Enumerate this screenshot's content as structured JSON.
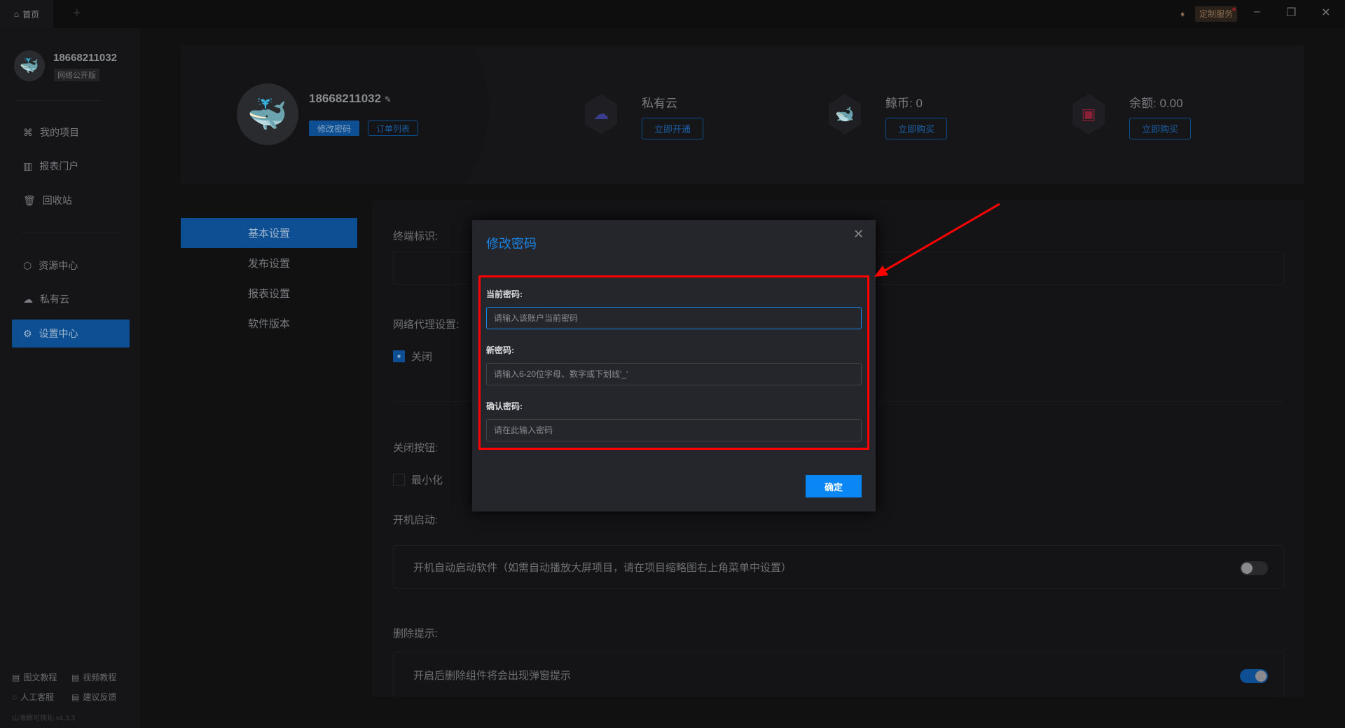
{
  "tabbar": {
    "home_tab": "首页",
    "add_tab": "+",
    "custom_service": "定制服务",
    "minimize": "–",
    "restore": "❐",
    "close": "✕"
  },
  "sidebar": {
    "username": "18668211032",
    "edition": "网络公开版",
    "items": [
      {
        "label": "我的项目",
        "icon": "⌘"
      },
      {
        "label": "报表门户",
        "icon": "▥"
      },
      {
        "label": "回收站",
        "icon": "🗑"
      },
      {
        "label": "资源中心",
        "icon": "⬡"
      },
      {
        "label": "私有云",
        "icon": "☁"
      },
      {
        "label": "设置中心",
        "icon": "⚙"
      }
    ],
    "footer": [
      {
        "label": "图文教程"
      },
      {
        "label": "视频教程"
      },
      {
        "label": "人工客服"
      },
      {
        "label": "建议反馈"
      }
    ],
    "version": "山海鲸可视化 v4.3.3"
  },
  "profile": {
    "username": "18668211032",
    "change_password": "修改密码",
    "order_list": "订单列表",
    "stats": [
      {
        "title": "私有云",
        "button": "立即开通",
        "color": "#3a3d8e"
      },
      {
        "title": "鲸币: 0",
        "button": "立即购买",
        "color": "#8a5a10"
      },
      {
        "title": "余额: 0.00",
        "button": "立即购买",
        "color": "#8a2035"
      }
    ]
  },
  "settings_menu": [
    "基本设置",
    "发布设置",
    "报表设置",
    "软件版本"
  ],
  "settings": {
    "terminal_id": "终端标识:",
    "proxy": "网络代理设置:",
    "proxy_off": "关闭",
    "close_button": "关闭按钮:",
    "minimize": "最小化",
    "startup": "开机启动:",
    "startup_desc": "开机自动启动软件（如需自动播放大屏项目，请在项目缩略图右上角菜单中设置）",
    "startup_on": false,
    "delete_tip": "删除提示:",
    "delete_desc": "开启后删除组件将会出现弹窗提示",
    "delete_on": true
  },
  "modal": {
    "title": "修改密码",
    "current_label": "当前密码:",
    "current_placeholder": "请输入该账户当前密码",
    "new_label": "新密码:",
    "new_placeholder": "请输入6-20位字母、数字或下划线'_'",
    "confirm_label": "确认密码:",
    "confirm_placeholder": "请在此输入密码",
    "ok": "确定",
    "close": "✕"
  }
}
